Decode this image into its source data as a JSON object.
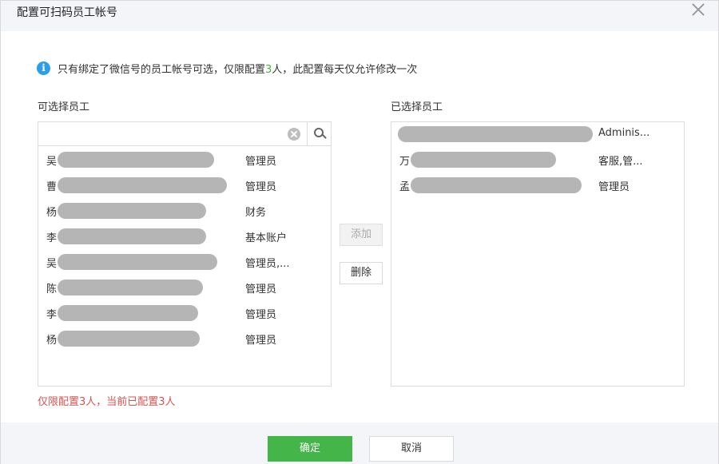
{
  "dialog": {
    "title": "配置可扫码员工帐号"
  },
  "notice": {
    "before": "只有绑定了微信号的员工帐号可选，仅限配置",
    "count": "3",
    "after": "人，此配置每天仅允许修改一次"
  },
  "left": {
    "label": "可选择员工",
    "search_placeholder": "",
    "items": [
      {
        "name": "吴",
        "role": "管理员"
      },
      {
        "name": "曹",
        "role": "管理员"
      },
      {
        "name": "杨",
        "role": "财务"
      },
      {
        "name": "李",
        "role": "基本账户"
      },
      {
        "name": "吴",
        "role": "管理员,..."
      },
      {
        "name": "陈",
        "role": "管理员"
      },
      {
        "name": "李",
        "role": "管理员"
      },
      {
        "name": "杨",
        "role": "管理员"
      }
    ]
  },
  "right": {
    "label": "已选择员工",
    "items": [
      {
        "name": "",
        "role": "Adminis..."
      },
      {
        "name": "万",
        "role": "客服,管..."
      },
      {
        "name": "孟",
        "role": "管理员"
      }
    ]
  },
  "buttons": {
    "add": "添加",
    "delete": "删除",
    "ok": "确定",
    "cancel": "取消"
  },
  "limit_text": "仅限配置3人，当前已配置3人",
  "colors": {
    "accent": "#44b549",
    "info": "#2a9ee8",
    "warning": "#d9534f"
  }
}
